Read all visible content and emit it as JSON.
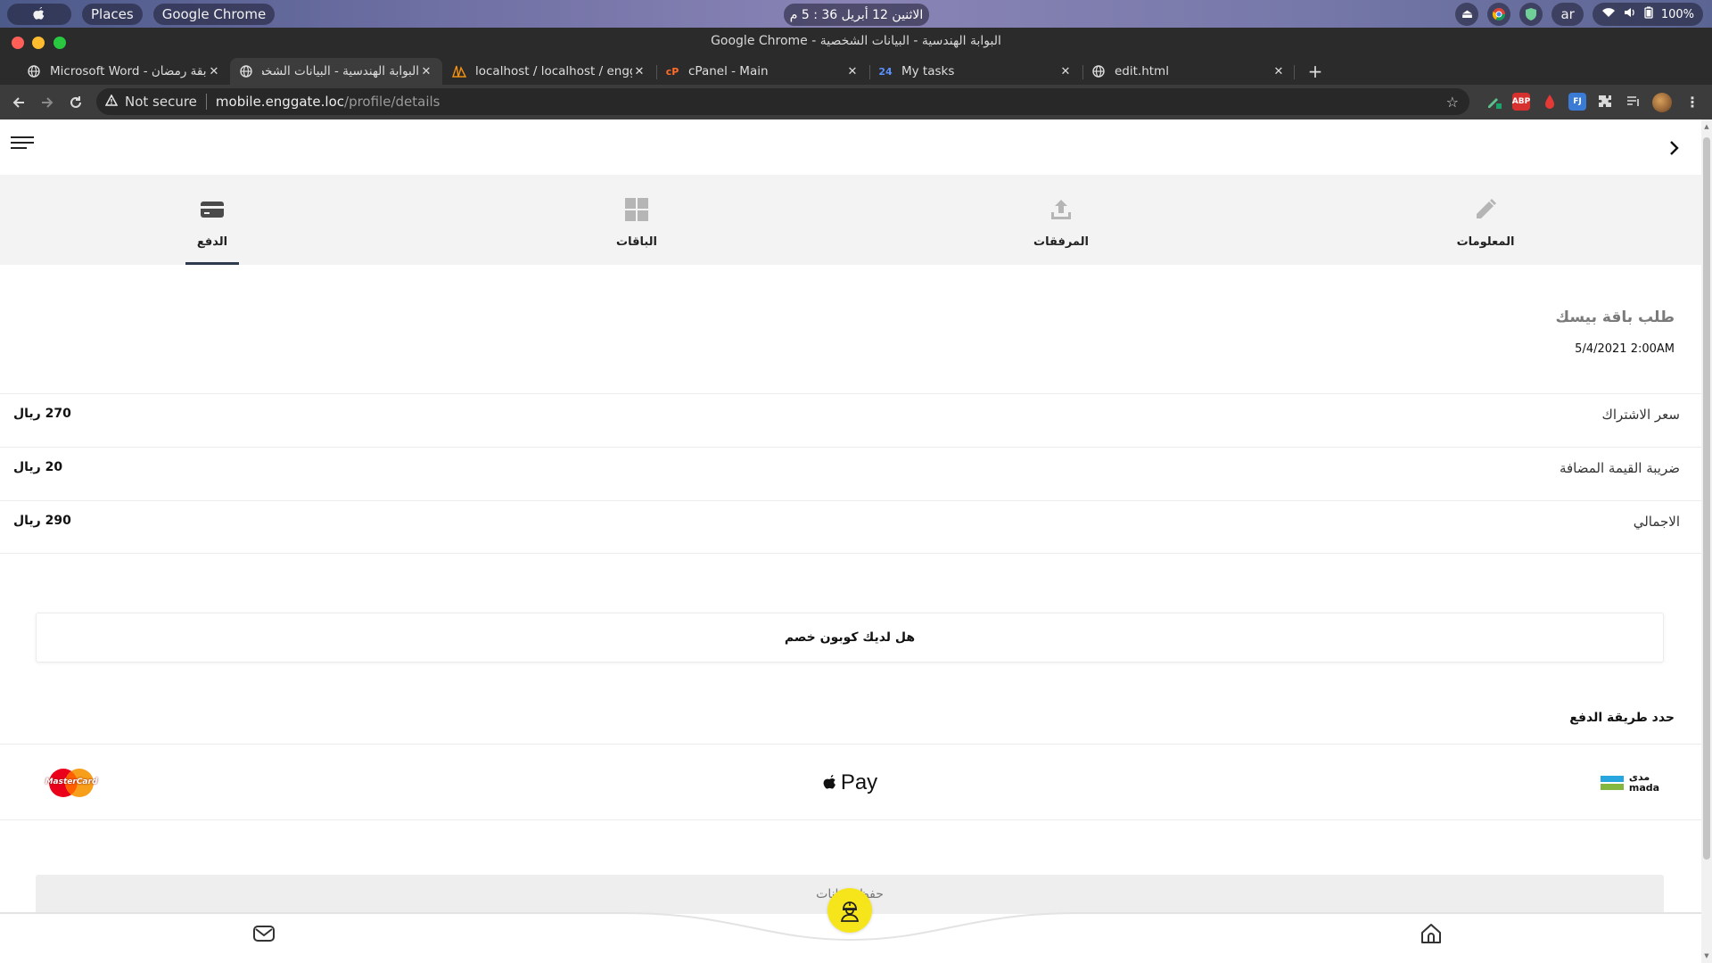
{
  "os": {
    "apple_label": "",
    "places": "Places",
    "active_app": "Google Chrome",
    "clock": "الاثنين 12 أبريل  36 : 5 م",
    "keyboard_layout": "ar",
    "battery": "100%"
  },
  "window": {
    "title": "Google Chrome - البوابة الهندسية - البيانات الشخصية"
  },
  "tabs": [
    {
      "label": "Microsoft Word - مسابقة رمضان",
      "favicon": "globe-icon",
      "active": false
    },
    {
      "label": "البوابة الهندسية - البيانات الشخصية",
      "favicon": "globe-icon",
      "active": true
    },
    {
      "label": "localhost / localhost / enggate",
      "favicon": "phpmyadmin-icon",
      "active": false
    },
    {
      "label": "cPanel - Main",
      "favicon": "cpanel-icon",
      "active": false
    },
    {
      "label": "My tasks",
      "favicon": "tasks-icon",
      "active": false
    },
    {
      "label": "edit.html",
      "favicon": "globe-icon",
      "active": false
    }
  ],
  "addressbar": {
    "security": "Not secure",
    "host": "mobile.enggate.loc",
    "path": "/profile/details"
  },
  "profile_tabs": [
    {
      "label": "المعلومات",
      "icon": "pencil-icon",
      "active": false
    },
    {
      "label": "المرفقات",
      "icon": "upload-icon",
      "active": false
    },
    {
      "label": "الباقات",
      "icon": "grid-icon",
      "active": false
    },
    {
      "label": "الدفع",
      "icon": "card-icon",
      "active": true
    }
  ],
  "order": {
    "title": "طلب باقة بيسك",
    "date": "5/4/2021 2:00AM"
  },
  "pricing": [
    {
      "label": "سعر الاشتراك",
      "value": "270 ريال"
    },
    {
      "label": "ضريبة القيمة المضافة",
      "value": "20 ريال"
    },
    {
      "label": "الاجمالي",
      "value": "290 ريال"
    }
  ],
  "coupon_label": "هل لديك كوبون خصم",
  "payment": {
    "heading": "حدد طريقة الدفع",
    "mada_ar": "مدى",
    "mada_en": "mada",
    "applepay": "Pay",
    "mastercard": "MasterCard"
  },
  "save_label": "حفظ البيانات",
  "colors": {
    "accent": "#f7e51c",
    "tab_underline": "#2e3b4e",
    "chrome_dark": "#2b2b2b"
  }
}
